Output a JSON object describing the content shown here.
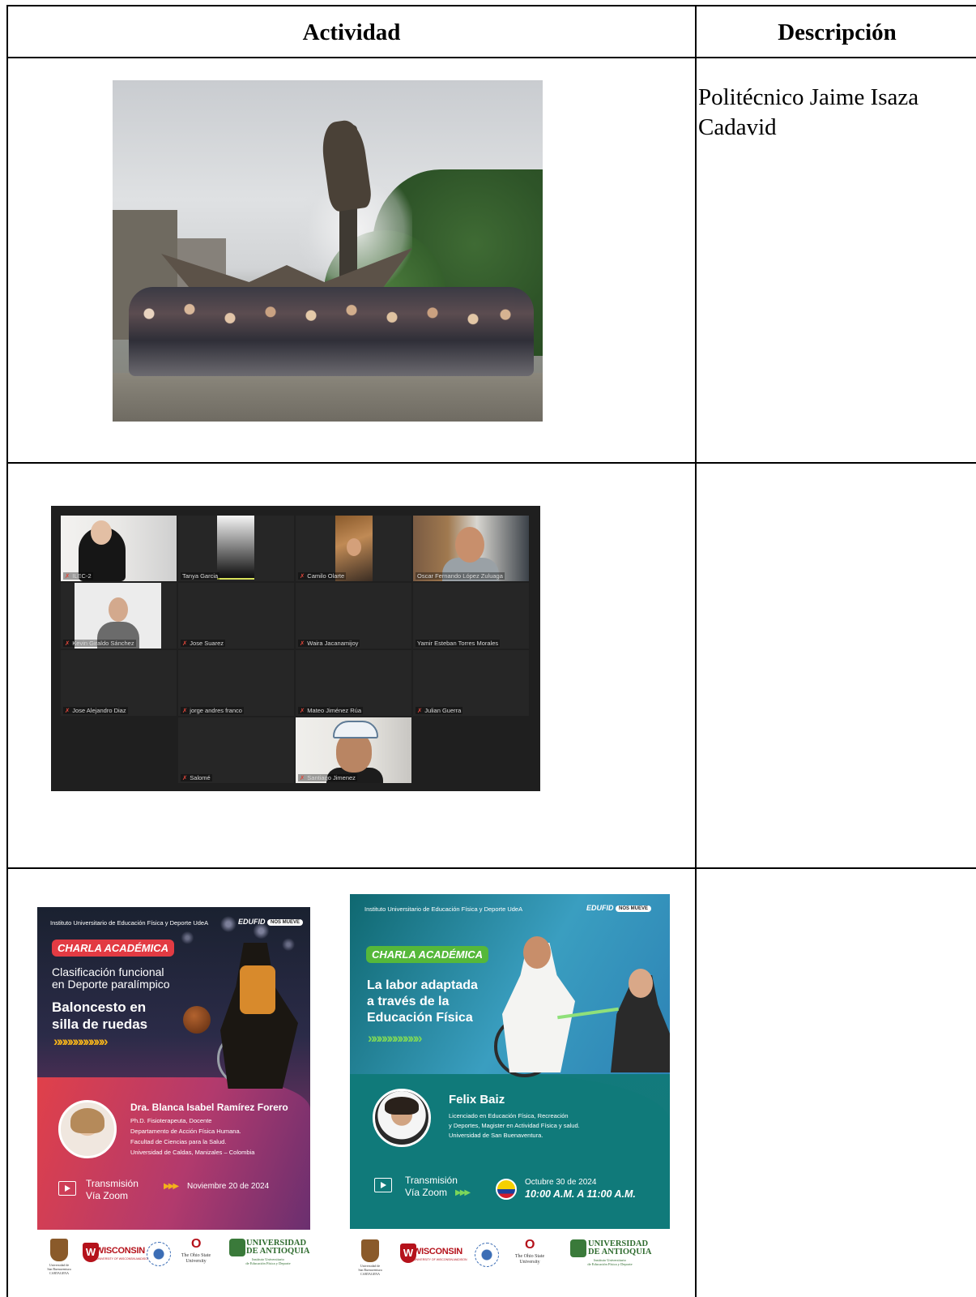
{
  "table": {
    "header": {
      "col_activity": "Actividad",
      "col_description": "Descripción"
    },
    "rows": [
      {
        "description": "Politécnico Jaime Isaza Cadavid"
      },
      {
        "description": ""
      },
      {
        "description": ""
      }
    ]
  },
  "zoom_participants": [
    {
      "name": "ILEC-2",
      "muted": true
    },
    {
      "name": "Tanya Garcia",
      "muted": false
    },
    {
      "name": "Camilo Olarte",
      "muted": true
    },
    {
      "name": "Oscar Fernando López Zuluaga",
      "muted": false,
      "active_speaker": true
    },
    {
      "name": "Kevin Giraldo Sánchez",
      "muted": true
    },
    {
      "name": "Jose Suarez",
      "muted": true
    },
    {
      "name": "Waira Jacanamijoy",
      "muted": true
    },
    {
      "name": "Yamir Esteban Torres Morales",
      "muted": false
    },
    {
      "name": "Jose Alejandro Diaz",
      "muted": true
    },
    {
      "name": "jorge andres franco",
      "muted": true
    },
    {
      "name": "Mateo Jiménez Rúa",
      "muted": true
    },
    {
      "name": "Julian Guerra",
      "muted": true
    },
    {
      "name": "Salomé",
      "muted": true
    },
    {
      "name": "Santiago Jimenez",
      "muted": true
    }
  ],
  "poster1": {
    "institute": "Instituto Universitario de Educación Física y Deporte UdeA",
    "brand": "EDUFID",
    "brand_tag": "NOS MUEVE",
    "badge": "CHARLA ACADÉMICA",
    "subtitle_line1": "Clasificación funcional",
    "subtitle_line2": "en Deporte paralímpico",
    "title_line1": "Baloncesto en",
    "title_line2": "silla de ruedas",
    "arrows": "»»»»»»»»»»",
    "speaker": "Dra. Blanca Isabel Ramírez Forero",
    "bio": [
      "Ph.D. Fisioterapeuta, Docente",
      "Departamento de Acción Física Humana.",
      "Facultad de Ciencias para la Salud.",
      "Universidad de Caldas, Manizales – Colombia"
    ],
    "transmission_line1": "Transmisión",
    "transmission_line2": "Vía Zoom",
    "date_arrows": "▶▶▶",
    "date": "Noviembre 20 de 2024",
    "colors": {
      "badge": "#e23b43",
      "arrows": "#f3b21b"
    }
  },
  "poster2": {
    "institute": "Instituto Universitario de Educación Física y Deporte UdeA",
    "brand": "EDUFID",
    "brand_tag": "NOS MUEVE",
    "badge": "CHARLA ACADÉMICA",
    "title_line1": "La labor adaptada",
    "title_line2": "a través de la",
    "title_line3": "Educación Física",
    "arrows": "»»»»»»»»»»",
    "speaker": "Felix Baiz",
    "bio": [
      "Licenciado en Educación Física, Recreación",
      "y Deportes, Magister en Actividad Física y salud.",
      "Universidad de San Buenaventura."
    ],
    "transmission_line1": "Transmisión",
    "transmission_line2": "Vía Zoom",
    "transmission_arrows": "▶▶▶",
    "date": "Octubre 30 de 2024",
    "time": "10:00 A.M. A 11:00 A.M.",
    "colors": {
      "badge": "#55b83a",
      "arrows": "#7cd65a"
    }
  },
  "logos": {
    "wisconsin": "WISCONSIN",
    "wisconsin_sub": "UNIVERSITY OF WISCONSIN-MADISON",
    "osu_mark": "O",
    "osu_line1": "The Ohio State",
    "osu_line2": "University",
    "udea_line1": "UNIVERSIDAD",
    "udea_line2": "DE ANTIOQUIA",
    "udea_sub1": "Instituto Universitario",
    "udea_sub2": "de Educación Física y Deporte",
    "usb_line1": "Universidad de",
    "usb_line2": "San Buenaventura",
    "usb_line3": "CARTAGENA"
  }
}
